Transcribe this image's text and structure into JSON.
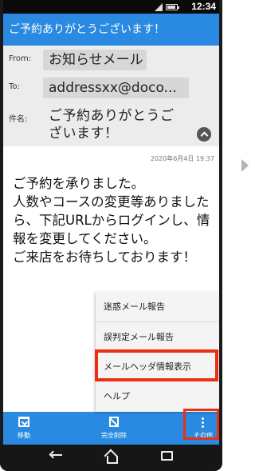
{
  "status_bar": {
    "time": "12:34"
  },
  "app_bar": {
    "title": "ご予約ありがとうございます！"
  },
  "header": {
    "from_label": "From:",
    "from_value": "お知らせメール",
    "to_label": "To:",
    "to_value": "addressxx@doco...",
    "subject_label": "件名:",
    "subject_value": "ご予約ありがとうございます！"
  },
  "message": {
    "date": "2020年6月4日 19:37",
    "body": "ご予約を承りました。\n人数やコースの変更等ありましたら、下記URLからログインし、情報を変更してください。\nご来店をお待ちしております！"
  },
  "menu": {
    "items": [
      "迷惑メール報告",
      "誤判定メール報告",
      "メールヘッダ情報表示",
      "ヘルプ"
    ],
    "highlighted_index": 2
  },
  "toolbar": {
    "move_label": "移動",
    "delete_label": "完全削除",
    "other_label": "その他"
  },
  "colors": {
    "app_bar": "#2a8ae2",
    "highlight": "#ea2f12",
    "header_bg": "#ececec"
  },
  "icons": [
    "signal-icon",
    "battery-icon",
    "collapse-icon",
    "move-icon",
    "delete-icon",
    "more-icon",
    "back-icon",
    "home-icon",
    "recent-apps-icon",
    "next-arrow-icon"
  ]
}
